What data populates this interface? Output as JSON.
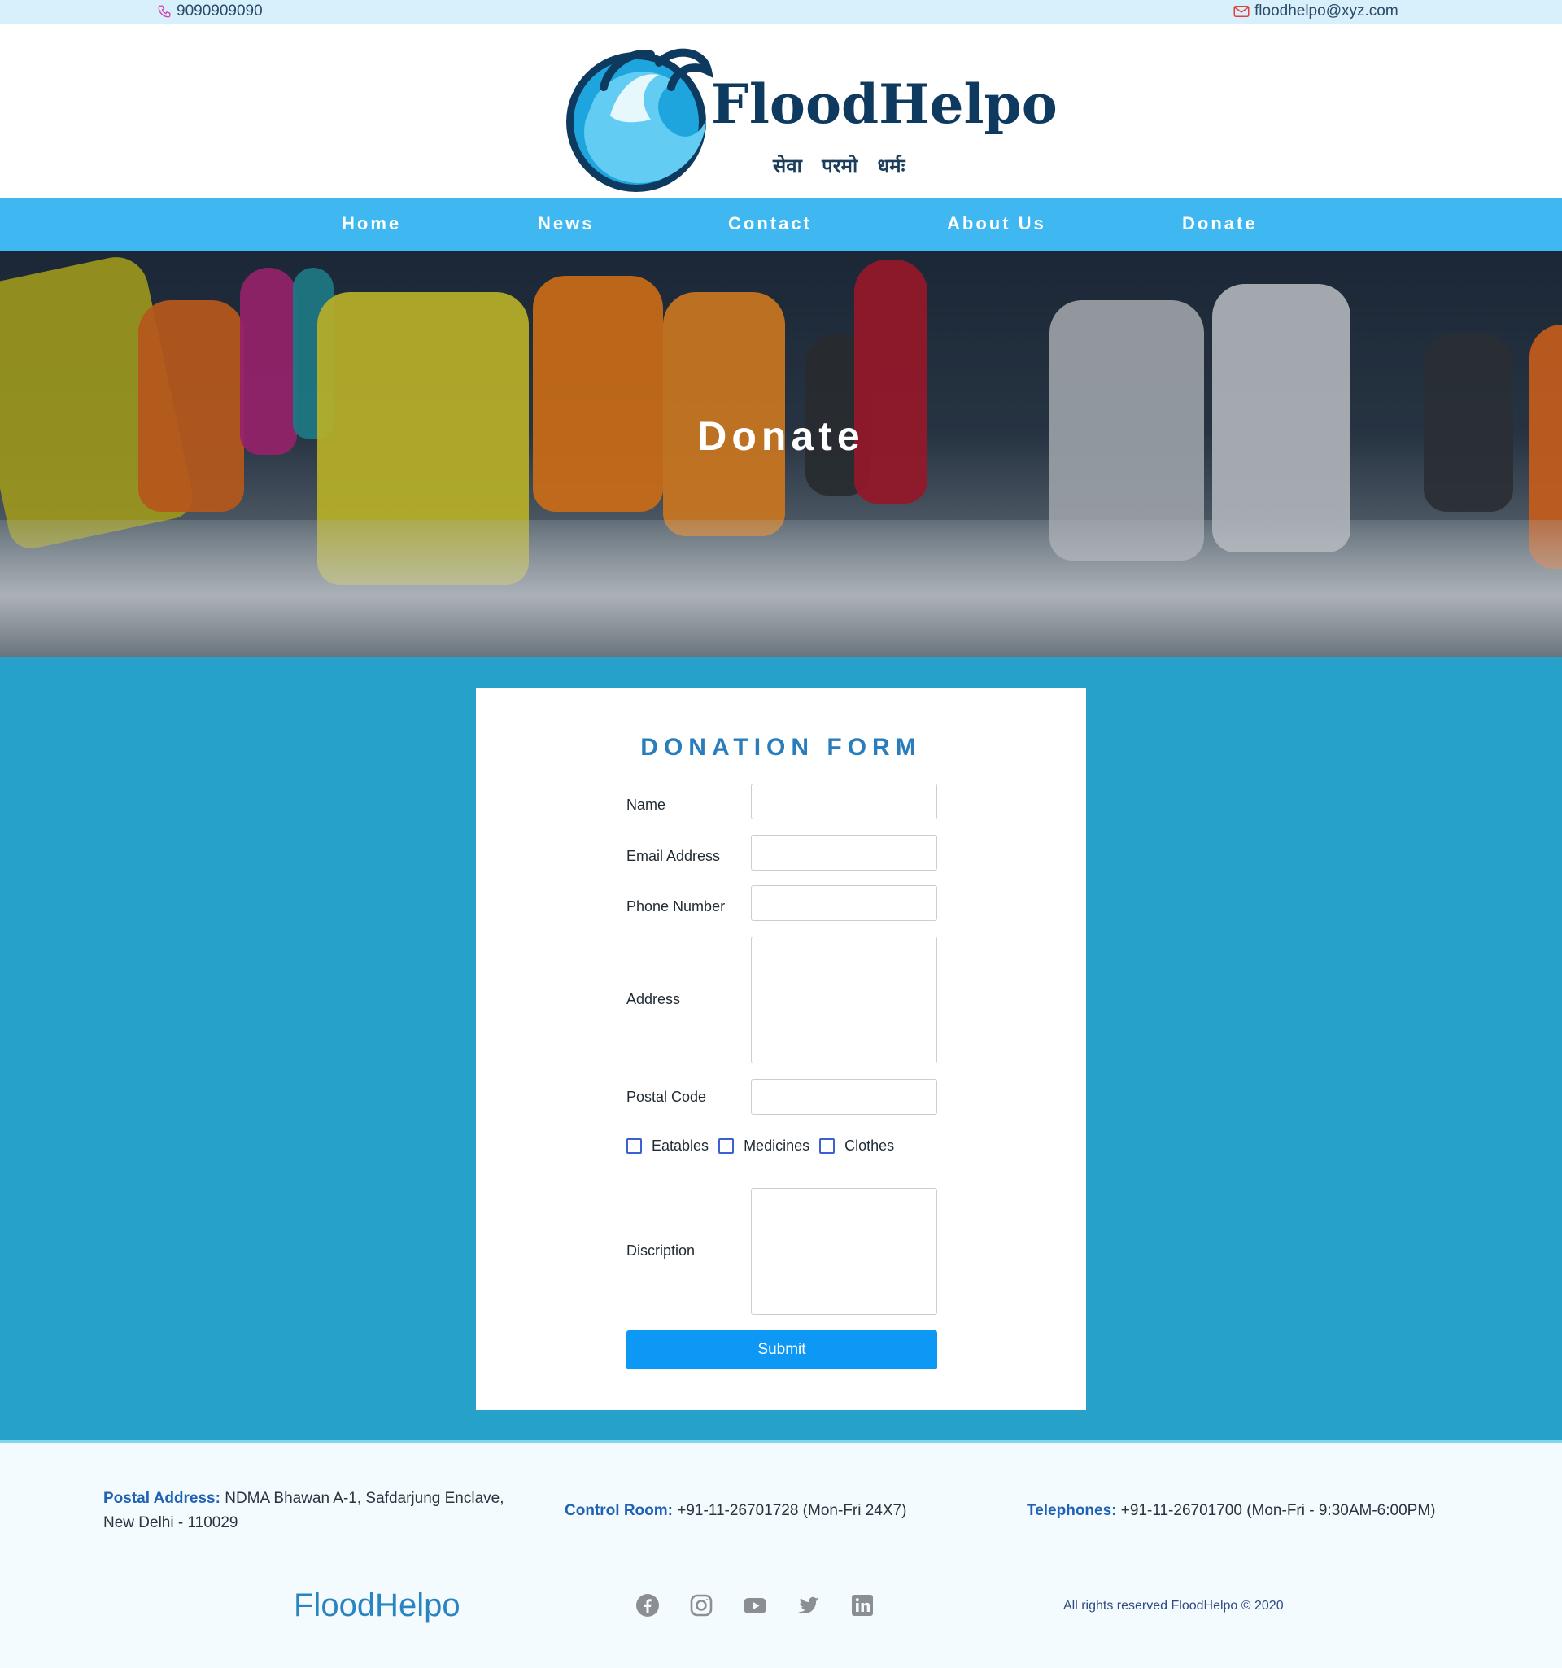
{
  "topbar": {
    "phone": "9090909090",
    "email": "floodhelpo@xyz.com"
  },
  "logo": {
    "name": "FloodHelpo",
    "tagline": "सेवा परमो धर्मः"
  },
  "nav": {
    "items": [
      "Home",
      "News",
      "Contact",
      "About Us",
      "Donate"
    ]
  },
  "hero": {
    "title": "Donate"
  },
  "form": {
    "title": "DONATION FORM",
    "fields": {
      "name": "Name",
      "email": "Email Address",
      "phone": "Phone Number",
      "address": "Address",
      "postal": "Postal Code",
      "description": "Discription"
    },
    "checkboxes": [
      "Eatables",
      "Medicines",
      "Clothes"
    ],
    "submit": "Submit"
  },
  "footer": {
    "postal_label": "Postal Address:",
    "postal_value": "NDMA Bhawan A-1, Safdarjung Enclave,",
    "postal_value2": "New Delhi - 110029",
    "control_label": "Control Room:",
    "control_value": "+91-11-26701728 (Mon-Fri 24X7)",
    "tel_label": "Telephones:",
    "tel_value": "+91-11-26701700 (Mon-Fri - 9:30AM-6:00PM)",
    "brand": "FloodHelpo",
    "social_icons": [
      "facebook-icon",
      "instagram-icon",
      "youtube-icon",
      "twitter-icon",
      "linkedin-icon"
    ],
    "copyright": "All rights reserved FloodHelpo © 2020"
  }
}
